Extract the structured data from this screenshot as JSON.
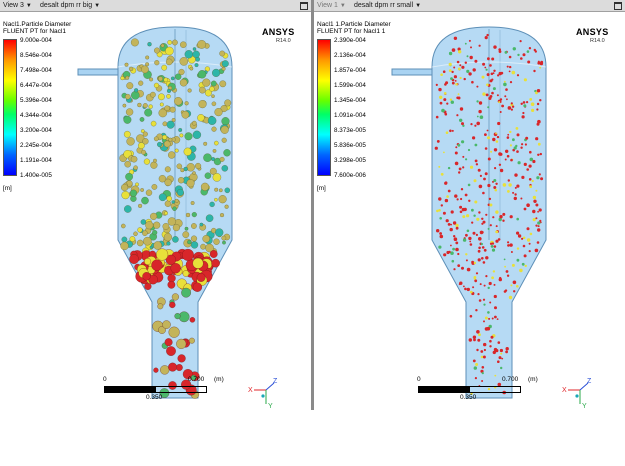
{
  "views": [
    {
      "id": "left",
      "view_label": "View 3",
      "case_label": "desalt dpm rr big",
      "legend": {
        "title_line1": "Nacl1.Particle Diameter",
        "title_line2": "FLUENT PT for Nacl1",
        "ticks": [
          "9.000e-004",
          "8.546e-004",
          "7.498e-004",
          "6.447e-004",
          "5.396e-004",
          "4.344e-004",
          "3.200e-004",
          "2.245e-004",
          "1.191e-004",
          "1.400e-005"
        ],
        "unit": "[m]"
      },
      "brand": "ANSYS",
      "brand_version": "R14.0",
      "scale": {
        "start": "0",
        "mid": "0.350",
        "end": "0.700",
        "unit": "(m)"
      },
      "particle_style": "large"
    },
    {
      "id": "right",
      "view_label": "View 1",
      "case_label": "desalt dpm rr small",
      "legend": {
        "title_line1": "Nacl1 1.Particle Diameter",
        "title_line2": "FLUENT PT for Nacl1 1",
        "ticks": [
          "2.390e-004",
          "2.136e-004",
          "1.857e-004",
          "1.599e-004",
          "1.345e-004",
          "1.091e-004",
          "8.373e-005",
          "5.836e-005",
          "3.298e-005",
          "7.600e-006"
        ],
        "unit": "[m]"
      },
      "brand": "ANSYS",
      "brand_version": "R14.0",
      "scale": {
        "start": "0",
        "mid": "0.350",
        "end": "0.700",
        "unit": "(m)"
      },
      "particle_style": "small"
    }
  ],
  "colors": {
    "vessel_fill": "#a9d3f2",
    "vessel_stroke": "#5d8fb7",
    "red": "#d8262a",
    "yellow": "#e8e03a",
    "khaki": "#c3b45a",
    "green": "#4ab86a",
    "teal": "#2cb5a8"
  },
  "axes": {
    "x": "X",
    "y": "Y",
    "z": "Z"
  }
}
